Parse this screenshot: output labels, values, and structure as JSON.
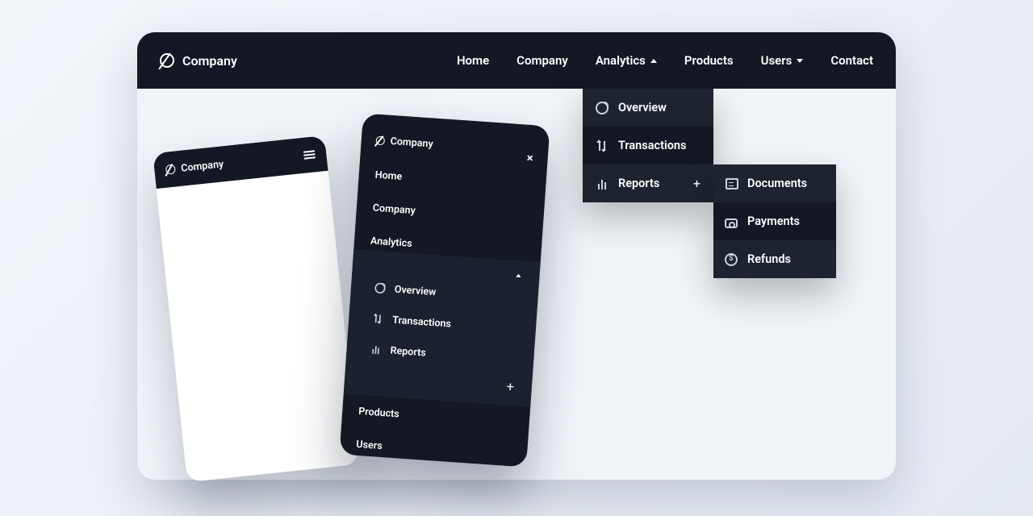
{
  "brand": "Company",
  "nav": {
    "home": "Home",
    "company": "Company",
    "analytics": "Analytics",
    "products": "Products",
    "users": "Users",
    "contact": "Contact"
  },
  "analytics_menu": {
    "overview": "Overview",
    "transactions": "Transactions",
    "reports": "Reports"
  },
  "reports_menu": {
    "documents": "Documents",
    "payments": "Payments",
    "refunds": "Refunds"
  },
  "mobile": {
    "home": "Home",
    "company": "Company",
    "analytics": "Analytics",
    "overview": "Overview",
    "transactions": "Transactions",
    "reports": "Reports",
    "products": "Products",
    "users": "Users"
  }
}
